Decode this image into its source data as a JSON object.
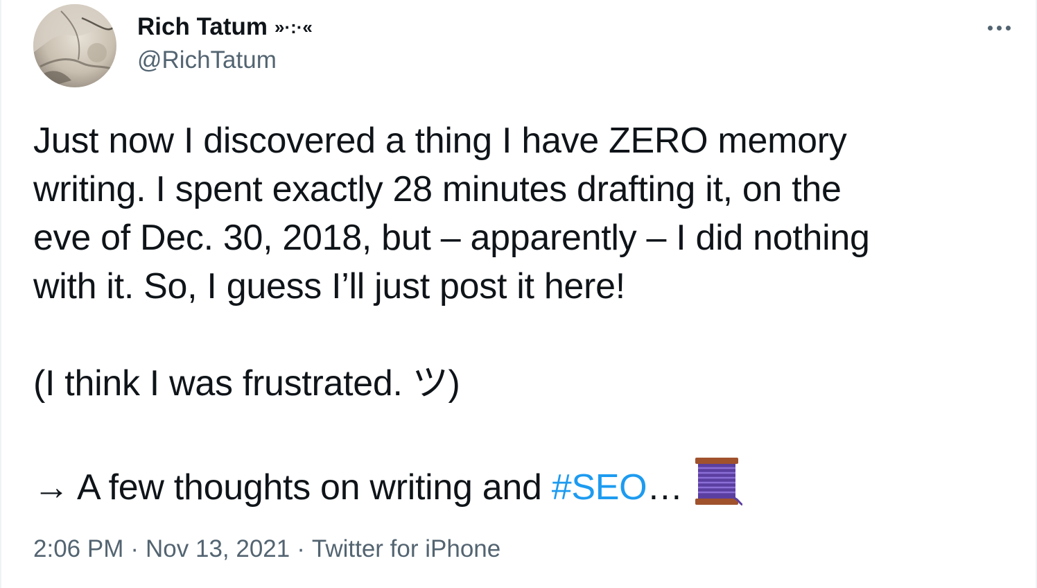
{
  "author": {
    "display_name": "Rich Tatum",
    "name_decoration": "»·:·«",
    "handle": "@RichTatum"
  },
  "more_menu": {
    "icon": "more-horizontal-icon"
  },
  "tweet": {
    "paragraph_1": "Just now I discovered a thing I have ZERO memory\nwriting. I spent exactly 28 minutes drafting it, on the\neve of Dec. 30, 2018, but – apparently – I did nothing\nwith it. So, I guess I’ll just post it here!",
    "paragraph_2": "(I think I was frustrated. ツ)",
    "paragraph_3_prefix": "→ A few thoughts on writing and ",
    "hashtag": "#SEO",
    "ellipsis": "…",
    "thread_emoji": "thread-spool-icon"
  },
  "meta": {
    "time": "2:06 PM",
    "separator": "·",
    "date": "Nov 13, 2021",
    "source": "Twitter for iPhone"
  },
  "colors": {
    "text": "#0f1419",
    "secondary": "#536471",
    "link": "#1d9bf0"
  }
}
